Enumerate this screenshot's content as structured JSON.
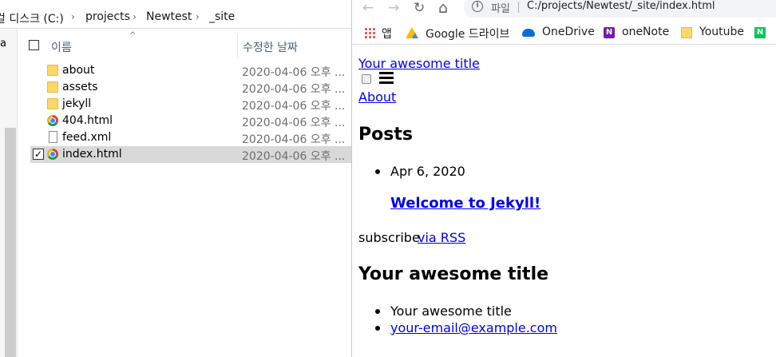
{
  "explorer": {
    "left_pane_fragment": "a",
    "breadcrumb": [
      "컬 디스크 (C:)",
      "projects",
      "Newtest",
      "_site"
    ],
    "columns": {
      "name": "이름",
      "date": "수정한 날짜"
    },
    "rows": [
      {
        "name": "about",
        "type": "folder",
        "date": "2020-04-06 오후 ...",
        "selected": false
      },
      {
        "name": "assets",
        "type": "folder",
        "date": "2020-04-06 오후 ...",
        "selected": false
      },
      {
        "name": "jekyll",
        "type": "folder",
        "date": "2020-04-06 오후 ...",
        "selected": false
      },
      {
        "name": "404.html",
        "type": "chrome",
        "date": "2020-04-06 오후 ...",
        "selected": false
      },
      {
        "name": "feed.xml",
        "type": "file",
        "date": "2020-04-06 오후 ...",
        "selected": false
      },
      {
        "name": "index.html",
        "type": "chrome",
        "date": "2020-04-06 오후 ...",
        "selected": true
      }
    ]
  },
  "browser": {
    "nav": {
      "back": "←",
      "forward": "→",
      "reload": "↻",
      "home": "⌂"
    },
    "address": {
      "scheme_label": "파일",
      "url": "C:/projects/Newtest/_site/index.html"
    },
    "bookmarks": [
      {
        "label": "앱",
        "icon": "apps-icon"
      },
      {
        "label": "Google 드라이브",
        "icon": "google-drive-icon"
      },
      {
        "label": "OneDrive",
        "icon": "onedrive-icon"
      },
      {
        "label": "oneNote",
        "icon": "onenote-icon"
      },
      {
        "label": "Youtube",
        "icon": "folder-icon"
      },
      {
        "label": "N",
        "icon": "naver-icon"
      }
    ],
    "page": {
      "site_title": "Your awesome title",
      "nav_link": "About",
      "posts_heading": "Posts",
      "post_date": "Apr 6, 2020",
      "post_title": "Welcome to Jekyll!",
      "subscribe_text": "subscribe",
      "subscribe_link": "via RSS",
      "footer_heading": "Your awesome title",
      "footer_items": [
        "Your awesome title",
        "your-email@example.com"
      ]
    }
  }
}
